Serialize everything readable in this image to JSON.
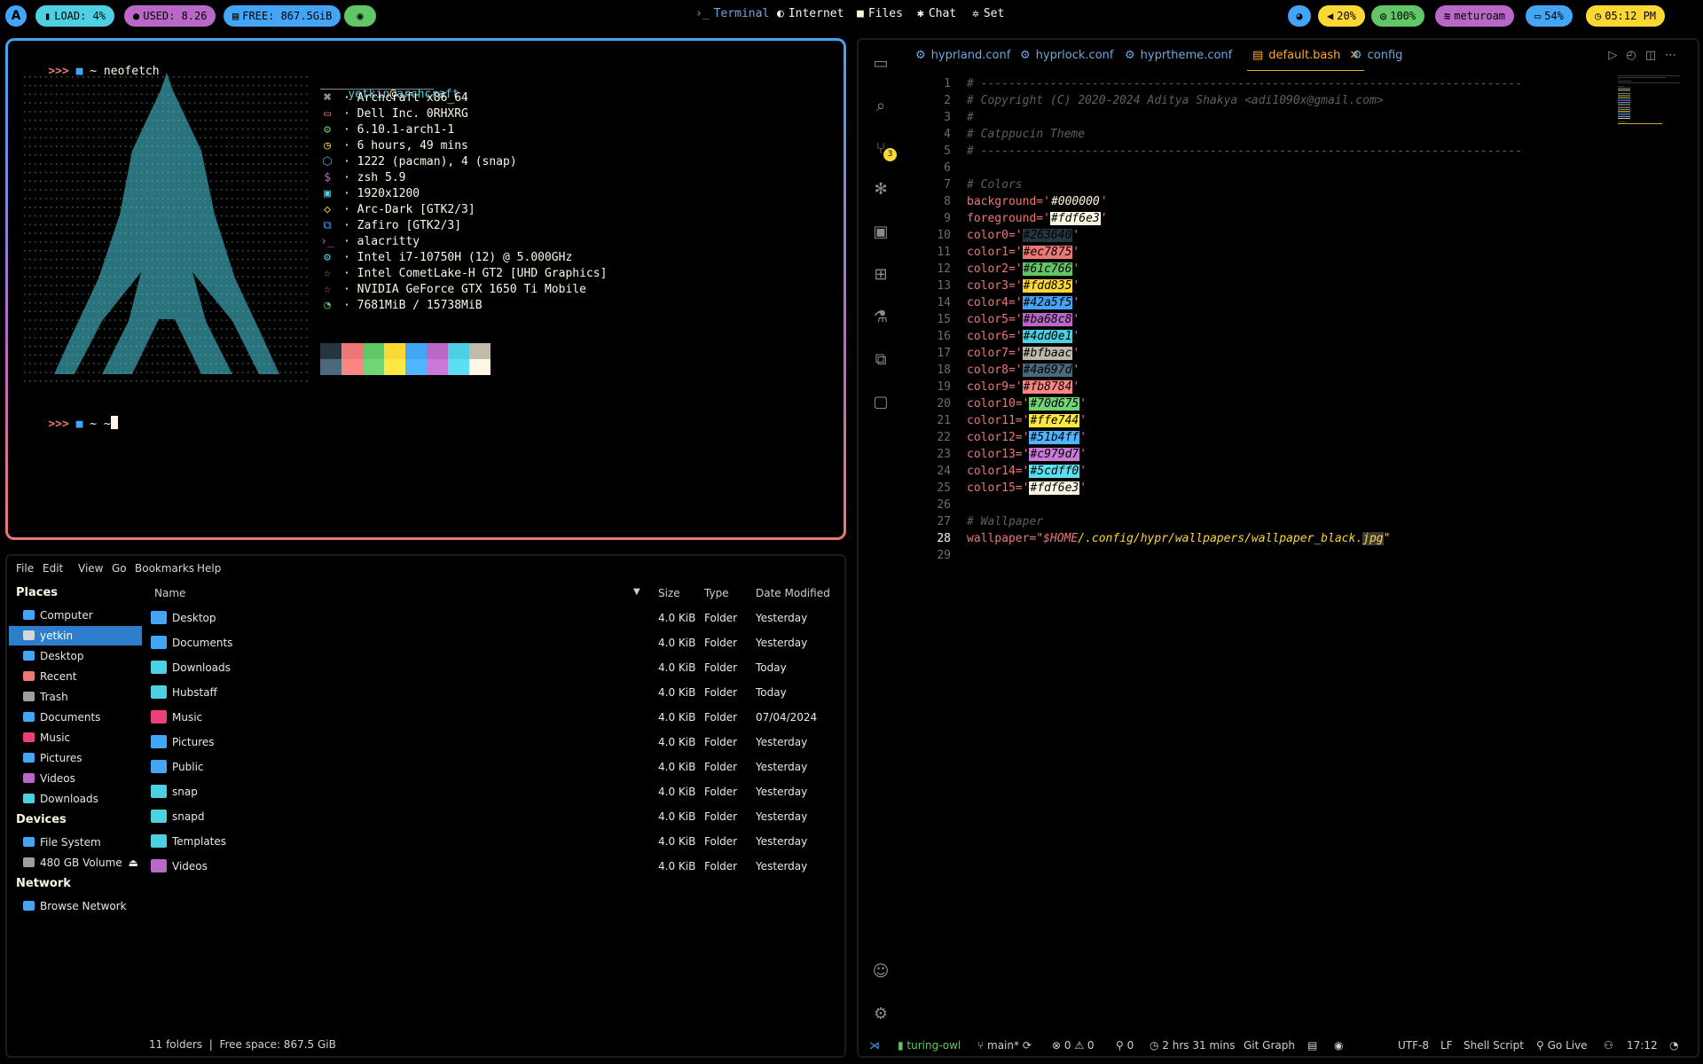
{
  "topbar": {
    "launcher_icon": "archcraft-logo",
    "load": "LOAD: 4%",
    "used": "USED: 8.26",
    "free": "FREE: 867.5GiB",
    "eye_icon": "eye-icon",
    "nav": [
      {
        "icon": "terminal-icon",
        "label": "Terminal",
        "active": true
      },
      {
        "icon": "globe-icon",
        "label": "Internet"
      },
      {
        "icon": "folder-icon",
        "label": "Files"
      },
      {
        "icon": "chat-icon",
        "label": "Chat"
      },
      {
        "icon": "gear-icon",
        "label": "Set"
      }
    ],
    "palette_icon": "palette-icon",
    "volume": "20%",
    "battery_alt": "100%",
    "wifi": "meturoam",
    "battery": "54%",
    "clock": "05:12 PM"
  },
  "terminal": {
    "prompt1": ">>> ",
    "cmd1": "~ neofetch",
    "user": "yetkin",
    "host": "archcraft",
    "info": [
      "· Archcraft x86_64",
      "· Dell Inc. 0RHXRG",
      "· 6.10.1-arch1-1",
      "· 6 hours, 49 mins",
      "· 1222 (pacman), 4 (snap)",
      "· zsh 5.9",
      "· 1920x1200",
      "· Arc-Dark [GTK2/3]",
      "· Zafiro [GTK2/3]",
      "· alacritty",
      "· Intel i7-10750H (12) @ 5.000GHz",
      "· Intel CometLake-H GT2 [UHD Graphics]",
      "· NVIDIA GeForce GTX 1650 Ti Mobile",
      "· 7681MiB / 15738MiB"
    ],
    "prompt2": ">>> ",
    "cmd2": "~ ~",
    "palette_top": [
      "#263640",
      "#ec7875",
      "#61c766",
      "#fdd835",
      "#42a5f5",
      "#ba68c8",
      "#4dd0e1",
      "#bfbaac"
    ],
    "palette_bottom": [
      "#4a697d",
      "#fb8784",
      "#70d675",
      "#ffe744",
      "#51b4ff",
      "#c979d7",
      "#5cdff0",
      "#fdf6e3"
    ]
  },
  "files": {
    "menu": [
      "File",
      "Edit",
      "View",
      "Go",
      "Bookmarks",
      "Help"
    ],
    "places_header": "Places",
    "places": [
      {
        "label": "Computer",
        "color": "#42a5f5"
      },
      {
        "label": "yetkin",
        "color": "#cfd8dc",
        "selected": true
      },
      {
        "label": "Desktop",
        "color": "#42a5f5"
      },
      {
        "label": "Recent",
        "color": "#ec7875"
      },
      {
        "label": "Trash",
        "color": "#9e9e9e"
      },
      {
        "label": "Documents",
        "color": "#42a5f5"
      },
      {
        "label": "Music",
        "color": "#ec407a"
      },
      {
        "label": "Pictures",
        "color": "#42a5f5"
      },
      {
        "label": "Videos",
        "color": "#ba68c8"
      },
      {
        "label": "Downloads",
        "color": "#4dd0e1"
      }
    ],
    "devices_header": "Devices",
    "devices": [
      {
        "label": "File System",
        "color": "#42a5f5"
      },
      {
        "label": "480 GB Volume",
        "color": "#9e9e9e"
      }
    ],
    "network_header": "Network",
    "network": [
      {
        "label": "Browse Network",
        "color": "#42a5f5"
      }
    ],
    "columns": {
      "name": "Name",
      "size": "Size",
      "type": "Type",
      "date": "Date Modified"
    },
    "rows": [
      {
        "name": "Desktop",
        "size": "4.0 KiB",
        "type": "Folder",
        "date": "Yesterday",
        "color": "#42a5f5"
      },
      {
        "name": "Documents",
        "size": "4.0 KiB",
        "type": "Folder",
        "date": "Yesterday",
        "color": "#42a5f5"
      },
      {
        "name": "Downloads",
        "size": "4.0 KiB",
        "type": "Folder",
        "date": "Today",
        "color": "#4dd0e1"
      },
      {
        "name": "Hubstaff",
        "size": "4.0 KiB",
        "type": "Folder",
        "date": "Today",
        "color": "#4dd0e1"
      },
      {
        "name": "Music",
        "size": "4.0 KiB",
        "type": "Folder",
        "date": "07/04/2024",
        "color": "#ec407a"
      },
      {
        "name": "Pictures",
        "size": "4.0 KiB",
        "type": "Folder",
        "date": "Yesterday",
        "color": "#42a5f5"
      },
      {
        "name": "Public",
        "size": "4.0 KiB",
        "type": "Folder",
        "date": "Yesterday",
        "color": "#42a5f5"
      },
      {
        "name": "snap",
        "size": "4.0 KiB",
        "type": "Folder",
        "date": "Yesterday",
        "color": "#4dd0e1"
      },
      {
        "name": "snapd",
        "size": "4.0 KiB",
        "type": "Folder",
        "date": "Yesterday",
        "color": "#4dd0e1"
      },
      {
        "name": "Templates",
        "size": "4.0 KiB",
        "type": "Folder",
        "date": "Yesterday",
        "color": "#4dd0e1"
      },
      {
        "name": "Videos",
        "size": "4.0 KiB",
        "type": "Folder",
        "date": "Yesterday",
        "color": "#ba68c8"
      }
    ],
    "status": "11 folders  |  Free space: 867.5 GiB"
  },
  "editor": {
    "tabs": [
      {
        "label": "hyprland.conf"
      },
      {
        "label": "hyprlock.conf"
      },
      {
        "label": "hyprtheme.conf"
      },
      {
        "label": "default.bash",
        "active": true
      },
      {
        "label": "config"
      }
    ],
    "scm_badge": "3",
    "lines": [
      {
        "n": "1",
        "t": "cm",
        "text": "# ------------------------------------------------------------------------------"
      },
      {
        "n": "2",
        "t": "cm",
        "text": "# Copyright (C) 2020-2024 Aditya Shakya <adi1090x@gmail.com>"
      },
      {
        "n": "3",
        "t": "cm",
        "text": "#"
      },
      {
        "n": "4",
        "t": "cm",
        "text": "# Catppucin Theme"
      },
      {
        "n": "5",
        "t": "cm",
        "text": "# ------------------------------------------------------------------------------"
      },
      {
        "n": "6",
        "t": "blank",
        "text": ""
      },
      {
        "n": "7",
        "t": "cm",
        "text": "# Colors"
      },
      {
        "n": "8",
        "t": "kv",
        "key": "background",
        "val": "#000000",
        "hl": ""
      },
      {
        "n": "9",
        "t": "kv",
        "key": "foreground",
        "val": "#fdf6e3",
        "hl": "#fdf6e3"
      },
      {
        "n": "10",
        "t": "kv",
        "key": "color0",
        "val": "#263640",
        "hl": "#263640"
      },
      {
        "n": "11",
        "t": "kv",
        "key": "color1",
        "val": "#ec7875",
        "hl": "#ec7875"
      },
      {
        "n": "12",
        "t": "kv",
        "key": "color2",
        "val": "#61c766",
        "hl": "#61c766"
      },
      {
        "n": "13",
        "t": "kv",
        "key": "color3",
        "val": "#fdd835",
        "hl": "#fdd835"
      },
      {
        "n": "14",
        "t": "kv",
        "key": "color4",
        "val": "#42a5f5",
        "hl": "#42a5f5"
      },
      {
        "n": "15",
        "t": "kv",
        "key": "color5",
        "val": "#ba68c8",
        "hl": "#ba68c8"
      },
      {
        "n": "16",
        "t": "kv",
        "key": "color6",
        "val": "#4dd0e1",
        "hl": "#4dd0e1"
      },
      {
        "n": "17",
        "t": "kv",
        "key": "color7",
        "val": "#bfbaac",
        "hl": "#bfbaac"
      },
      {
        "n": "18",
        "t": "kv",
        "key": "color8",
        "val": "#4a697d",
        "hl": "#4a697d"
      },
      {
        "n": "19",
        "t": "kv",
        "key": "color9",
        "val": "#fb8784",
        "hl": "#fb8784"
      },
      {
        "n": "20",
        "t": "kv",
        "key": "color10",
        "val": "#70d675",
        "hl": "#70d675"
      },
      {
        "n": "21",
        "t": "kv",
        "key": "color11",
        "val": "#ffe744",
        "hl": "#ffe744"
      },
      {
        "n": "22",
        "t": "kv",
        "key": "color12",
        "val": "#51b4ff",
        "hl": "#51b4ff"
      },
      {
        "n": "23",
        "t": "kv",
        "key": "color13",
        "val": "#c979d7",
        "hl": "#c979d7"
      },
      {
        "n": "24",
        "t": "kv",
        "key": "color14",
        "val": "#5cdff0",
        "hl": "#5cdff0"
      },
      {
        "n": "25",
        "t": "kv",
        "key": "color15",
        "val": "#fdf6e3",
        "hl": "#fdf6e3"
      },
      {
        "n": "26",
        "t": "blank",
        "text": ""
      },
      {
        "n": "27",
        "t": "cm",
        "text": "# Wallpaper"
      },
      {
        "n": "28",
        "t": "wp",
        "key": "wallpaper",
        "var": "$HOME",
        "path": "/.config/hypr/wallpapers/wallpaper_black.",
        "ext": "jpg"
      },
      {
        "n": "29",
        "t": "blank",
        "text": ""
      }
    ],
    "current_line": "28",
    "status": {
      "remote_icon": "remote-icon",
      "project": "turing-owl",
      "branch": "main*",
      "errors": "0",
      "warnings": "0",
      "ports": "0",
      "time": "2 hrs 31 mins",
      "git_graph": "Git Graph",
      "encoding": "UTF-8",
      "eol": "LF",
      "language": "Shell Script",
      "golive": "Go Live",
      "clock": "17:12"
    }
  }
}
